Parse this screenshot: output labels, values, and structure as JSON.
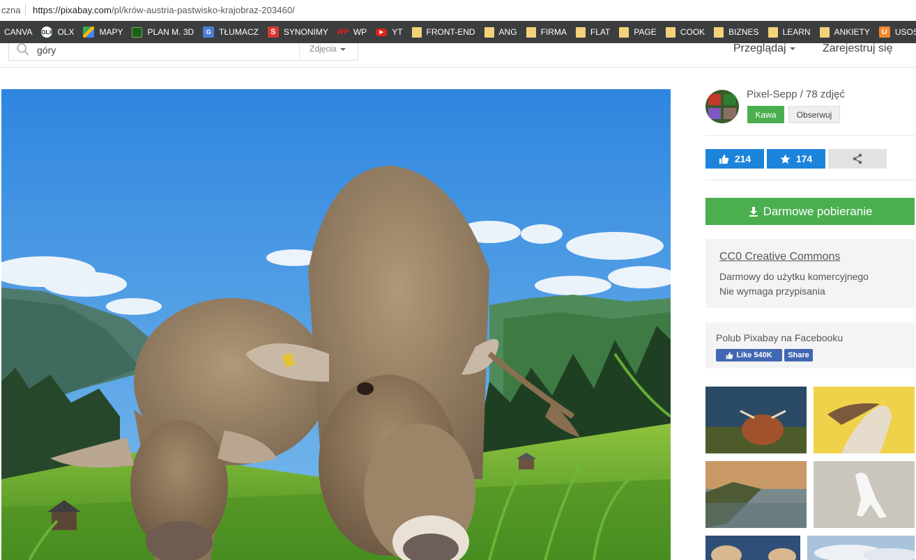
{
  "browser": {
    "tab_fragment": "czna",
    "url_host": "https://pixabay.com",
    "url_path": "/pl/krów-austria-pastwisko-krajobraz-203460/"
  },
  "bookmarks": [
    {
      "label": "CANVA",
      "icon": "none"
    },
    {
      "label": "OLX",
      "icon": "olx-icon"
    },
    {
      "label": "MAPY",
      "icon": "maps-icon"
    },
    {
      "label": "PLAN M. 3D",
      "icon": "plan-icon"
    },
    {
      "label": "TŁUMACZ",
      "icon": "translate-icon"
    },
    {
      "label": "SYNONIMY",
      "icon": "synonimy-icon"
    },
    {
      "label": "WP",
      "icon": "wp-icon"
    },
    {
      "label": "YT",
      "icon": "youtube-icon"
    },
    {
      "label": "FRONT-END",
      "icon": "folder-icon"
    },
    {
      "label": "ANG",
      "icon": "folder-icon"
    },
    {
      "label": "FIRMA",
      "icon": "folder-icon"
    },
    {
      "label": "FLAT",
      "icon": "folder-icon"
    },
    {
      "label": "PAGE",
      "icon": "folder-icon"
    },
    {
      "label": "COOK",
      "icon": "folder-icon"
    },
    {
      "label": "BIZNES",
      "icon": "folder-icon"
    },
    {
      "label": "LEARN",
      "icon": "folder-icon"
    },
    {
      "label": "ANKIETY",
      "icon": "folder-icon"
    },
    {
      "label": "USOS",
      "icon": "usos-icon"
    },
    {
      "label": "",
      "icon": "brave-icon"
    }
  ],
  "header": {
    "search_value": "góry",
    "search_type": "Zdjęcia",
    "browse_label": "Przeglądaj",
    "register_label": "Zarejestruj się"
  },
  "author": {
    "name": "Pixel-Sepp",
    "photo_count": "/ 78 zdjęć",
    "coffee_label": "Kawa",
    "follow_label": "Obserwuj"
  },
  "stats": {
    "likes": "214",
    "favorites": "174"
  },
  "download": {
    "label": "Darmowe pobieranie"
  },
  "license": {
    "title": "CC0 Creative Commons",
    "line1": "Darmowy do użytku komercyjnego",
    "line2": "Nie wymaga przypisania"
  },
  "facebook": {
    "title": "Polub Pixabay na Facebooku",
    "like_label": "Like 540K",
    "share_label": "Share"
  },
  "colors": {
    "bookmarks_bg": "#3b3d3f",
    "accent_green": "#4bae4f",
    "accent_blue": "#1d84dc",
    "facebook_blue": "#4267b2"
  }
}
